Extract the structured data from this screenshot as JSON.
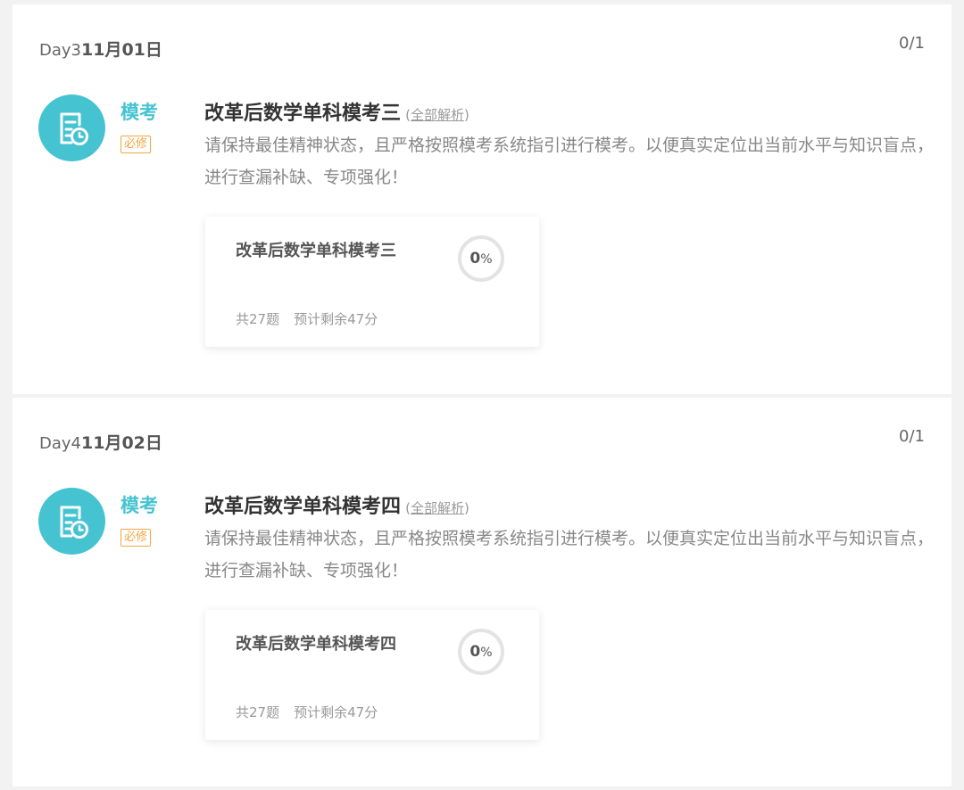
{
  "days": [
    {
      "day_prefix": "Day3",
      "date": "11月01日",
      "count": "0/1",
      "type_label": "模考",
      "badge": "必修",
      "title": "改革后数学单科模考三",
      "paren_open": "(",
      "analysis_link": "全部解析",
      "paren_close": ")",
      "description": "请保持最佳精神状态，且严格按照模考系统指引进行模考。以便真实定位出当前水平与知识盲点，进行查漏补缺、专项强化！",
      "card": {
        "title": "改革后数学单科模考三",
        "progress_value": "0",
        "progress_unit": "%",
        "question_count": "共27题",
        "time_remaining": "预计剩余47分"
      }
    },
    {
      "day_prefix": "Day4",
      "date": "11月02日",
      "count": "0/1",
      "type_label": "模考",
      "badge": "必修",
      "title": "改革后数学单科模考四",
      "paren_open": "(",
      "analysis_link": "全部解析",
      "paren_close": ")",
      "description": "请保持最佳精神状态，且严格按照模考系统指引进行模考。以便真实定位出当前水平与知识盲点，进行查漏补缺、专项强化！",
      "card": {
        "title": "改革后数学单科模考四",
        "progress_value": "0",
        "progress_unit": "%",
        "question_count": "共27题",
        "time_remaining": "预计剩余47分"
      }
    }
  ],
  "colors": {
    "accent": "#46c3d1",
    "badge": "#f0a640",
    "background": "#f2f2f2"
  },
  "icons": {
    "exam_icon": "exam-document-clock-icon"
  }
}
